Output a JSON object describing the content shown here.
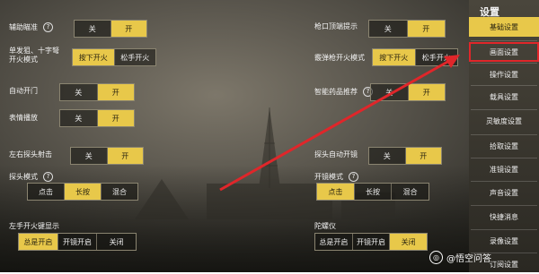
{
  "left_settings": [
    {
      "label": "辅助瞄准",
      "help": "?",
      "options": [
        "关",
        "开"
      ],
      "active": 1
    },
    {
      "label": "单发狙、十字弩\n开火模式",
      "options": [
        "按下开火",
        "松手开火"
      ],
      "active": 0
    },
    {
      "label": "自动开门",
      "options": [
        "关",
        "开"
      ],
      "active": 1
    },
    {
      "label": "表情播放",
      "options": [
        "关",
        "开"
      ],
      "active": 1
    },
    {
      "label": "左右探头射击",
      "options": [
        "关",
        "开"
      ],
      "active": 1
    },
    {
      "label": "探头模式",
      "help": "?",
      "options": [
        "点击",
        "长按",
        "混合"
      ],
      "active": 1
    },
    {
      "label": "左手开火键显示",
      "options": [
        "总是开启",
        "开镜开启",
        "关闭"
      ],
      "active": 0
    }
  ],
  "right_settings": [
    {
      "label": "枪口顶端提示",
      "options": [
        "关",
        "开"
      ],
      "active": 1
    },
    {
      "label": "霰弹枪开火模式",
      "options": [
        "按下开火",
        "松手开火"
      ],
      "active": 0
    },
    {
      "label": "智能药品推荐",
      "help": "?",
      "options": [
        "关",
        "开"
      ],
      "active": 1
    },
    {
      "label": "探头自动开镜",
      "options": [
        "关",
        "开"
      ],
      "active": 1
    },
    {
      "label": "开镜模式",
      "help": "?",
      "options": [
        "点击",
        "长按",
        "混合"
      ],
      "active": 0
    },
    {
      "label": "陀螺仪",
      "options": [
        "总是开启",
        "开镜开启",
        "关闭"
      ],
      "active": 2
    }
  ],
  "panel": {
    "title": "设置",
    "tabs": [
      "基础设置",
      "画面设置",
      "操作设置",
      "载具设置",
      "灵敏度设置",
      "拾取设置",
      "准镜设置",
      "声音设置",
      "快捷消息",
      "录像设置",
      "订阅设置"
    ],
    "active_tab": 0,
    "highlighted_tab": 1,
    "colors": {
      "accent": "#e8c84a",
      "annotation": "#e0262a"
    }
  },
  "watermark": {
    "text": "@悟空问答"
  }
}
